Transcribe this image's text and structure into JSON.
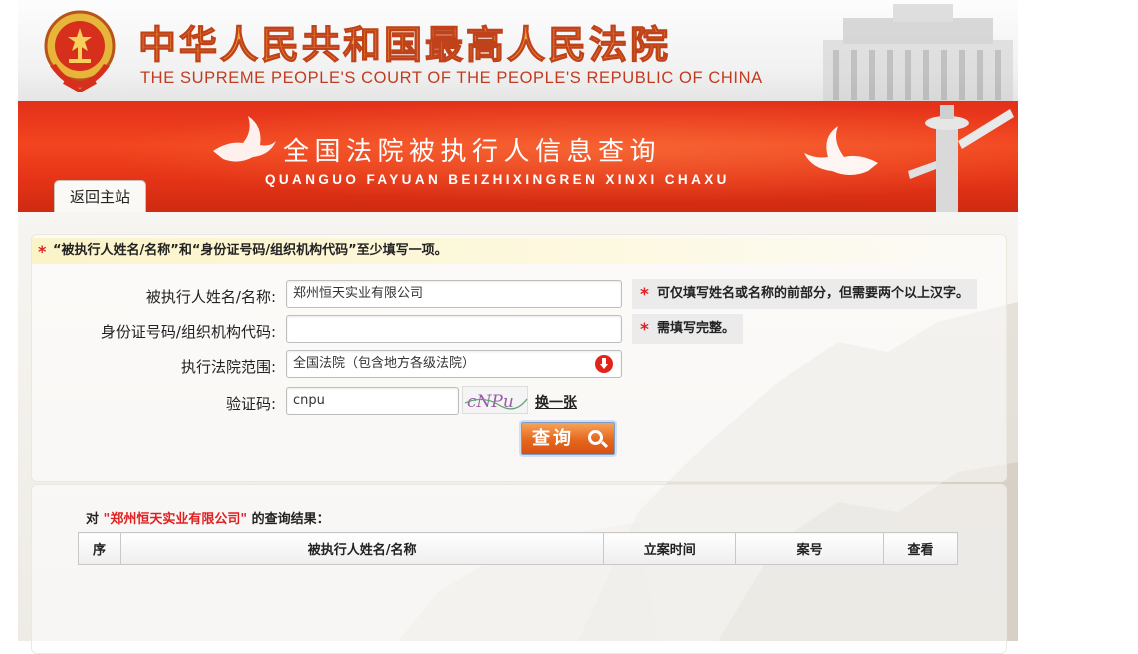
{
  "header": {
    "title_cn": "中华人民共和国最高人民法院",
    "title_en": "THE SUPREME PEOPLE'S COURT OF THE PEOPLE'S REPUBLIC OF CHINA"
  },
  "banner": {
    "title_cn": "全国法院被执行人信息查询",
    "title_en": "QUANGUO FAYUAN BEIZHIXINGREN XINXI CHAXU",
    "back_tab": "返回主站"
  },
  "notice": "“被执行人姓名/名称”和“身份证号码/组织机构代码”至少填写一项。",
  "form": {
    "name_label": "被执行人姓名/名称:",
    "name_value": "郑州恒天实业有限公司",
    "name_tip": "可仅填写姓名或名称的前部分，但需要两个以上汉字。",
    "id_label": "身份证号码/组织机构代码:",
    "id_value": "",
    "id_tip": "需填写完整。",
    "court_label": "执行法院范围:",
    "court_value": "全国法院（包含地方各级法院）",
    "captcha_label": "验证码:",
    "captcha_value": "cnpu",
    "captcha_image_text": "cNPu",
    "change_link": "换一张",
    "query_button": "查询"
  },
  "results": {
    "prefix": "对",
    "keyword": "\"郑州恒天实业有限公司\"",
    "suffix": "的查询结果：",
    "columns": [
      "序",
      "被执行人姓名/名称",
      "立案时间",
      "案号",
      "查看"
    ]
  },
  "colors": {
    "banner_red": "#e53417",
    "title_orange": "#f4a238",
    "required_star": "#e02020",
    "button_orange": "#e5671d"
  },
  "icons": {
    "emblem": "national-emblem-icon",
    "dove": "dove-icon",
    "pillar": "huabiao-pillar-icon",
    "select_arrow": "red-down-arrow-icon",
    "search": "magnifier-icon"
  }
}
